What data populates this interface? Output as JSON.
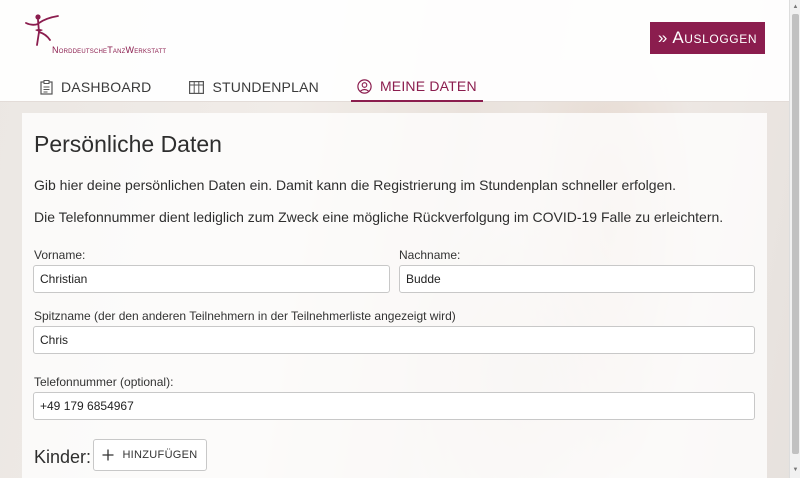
{
  "brand": {
    "name": "NorddeutscheTanzWerkstatt",
    "logo_icon": "ballerina-icon",
    "accent": "#8b1d4e"
  },
  "header": {
    "logout_label": "» Ausloggen",
    "nav": [
      {
        "label": "DASHBOARD",
        "icon": "clipboard-icon",
        "active": false
      },
      {
        "label": "STUNDENPLAN",
        "icon": "table-icon",
        "active": false
      },
      {
        "label": "MEINE DATEN",
        "icon": "user-circle-icon",
        "active": true
      }
    ]
  },
  "main": {
    "title": "Persönliche Daten",
    "intro": "Gib hier deine persönlichen Daten ein. Damit kann die Registrierung im Stundenplan schneller erfolgen.",
    "phone_note": "Die Telefonnummer dient lediglich zum Zweck eine mögliche Rückverfolgung im COVID-19 Falle zu erleichtern.",
    "fields": {
      "vorname": {
        "label": "Vorname:",
        "value": "Christian"
      },
      "nachname": {
        "label": "Nachname:",
        "value": "Budde"
      },
      "spitzname": {
        "label": "Spitzname (der den anderen Teilnehmern in der Teilnehmerliste angezeigt wird)",
        "value": "Chris"
      },
      "telefon": {
        "label": "Telefonnummer (optional):",
        "value": "+49 179 6854967"
      }
    },
    "kinder": {
      "label": "Kinder:",
      "add_label": "HINZUFÜGEN"
    }
  }
}
